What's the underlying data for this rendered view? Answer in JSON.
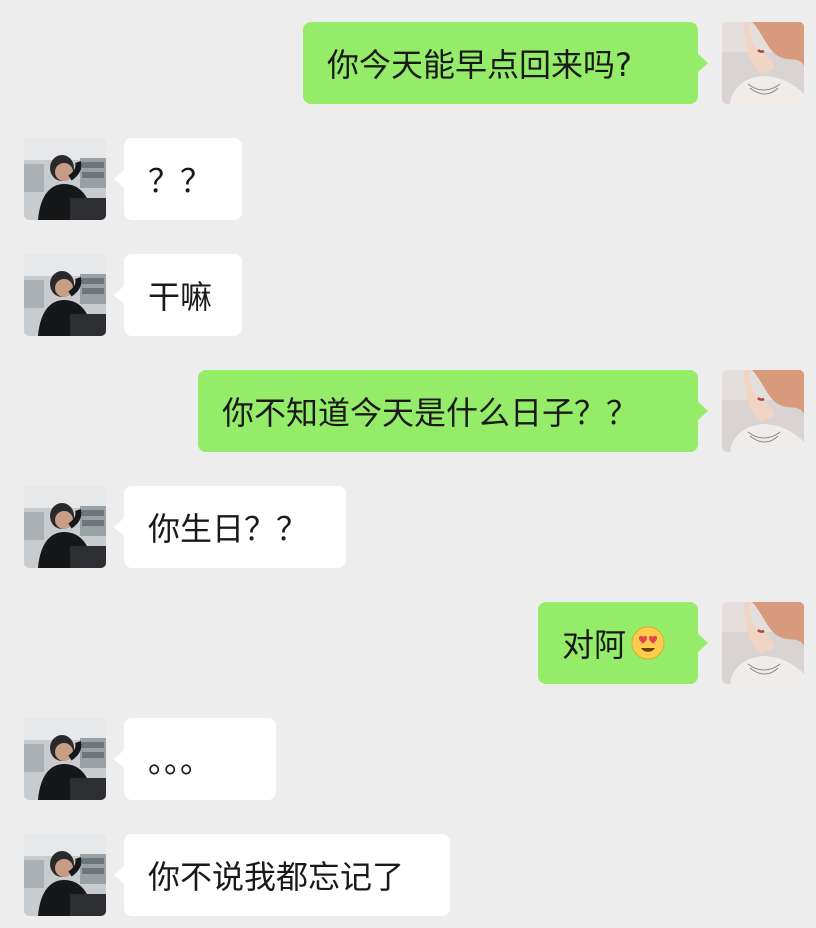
{
  "conversation": {
    "messages": [
      {
        "side": "out",
        "text": "你今天能早点回来吗?"
      },
      {
        "side": "in",
        "text": "？？"
      },
      {
        "side": "in",
        "text": "干嘛"
      },
      {
        "side": "out",
        "text": "你不知道今天是什么日子？？"
      },
      {
        "side": "in",
        "text": "你生日？？"
      },
      {
        "side": "out",
        "text": "对阿",
        "emoji": "heart-eyes-emoji"
      },
      {
        "side": "in",
        "text": "。。。"
      },
      {
        "side": "in",
        "text": "你不说我都忘记了"
      }
    ]
  },
  "colors": {
    "background": "#ededed",
    "incoming_bubble": "#ffffff",
    "outgoing_bubble": "#95ec69",
    "text": "#191919"
  }
}
